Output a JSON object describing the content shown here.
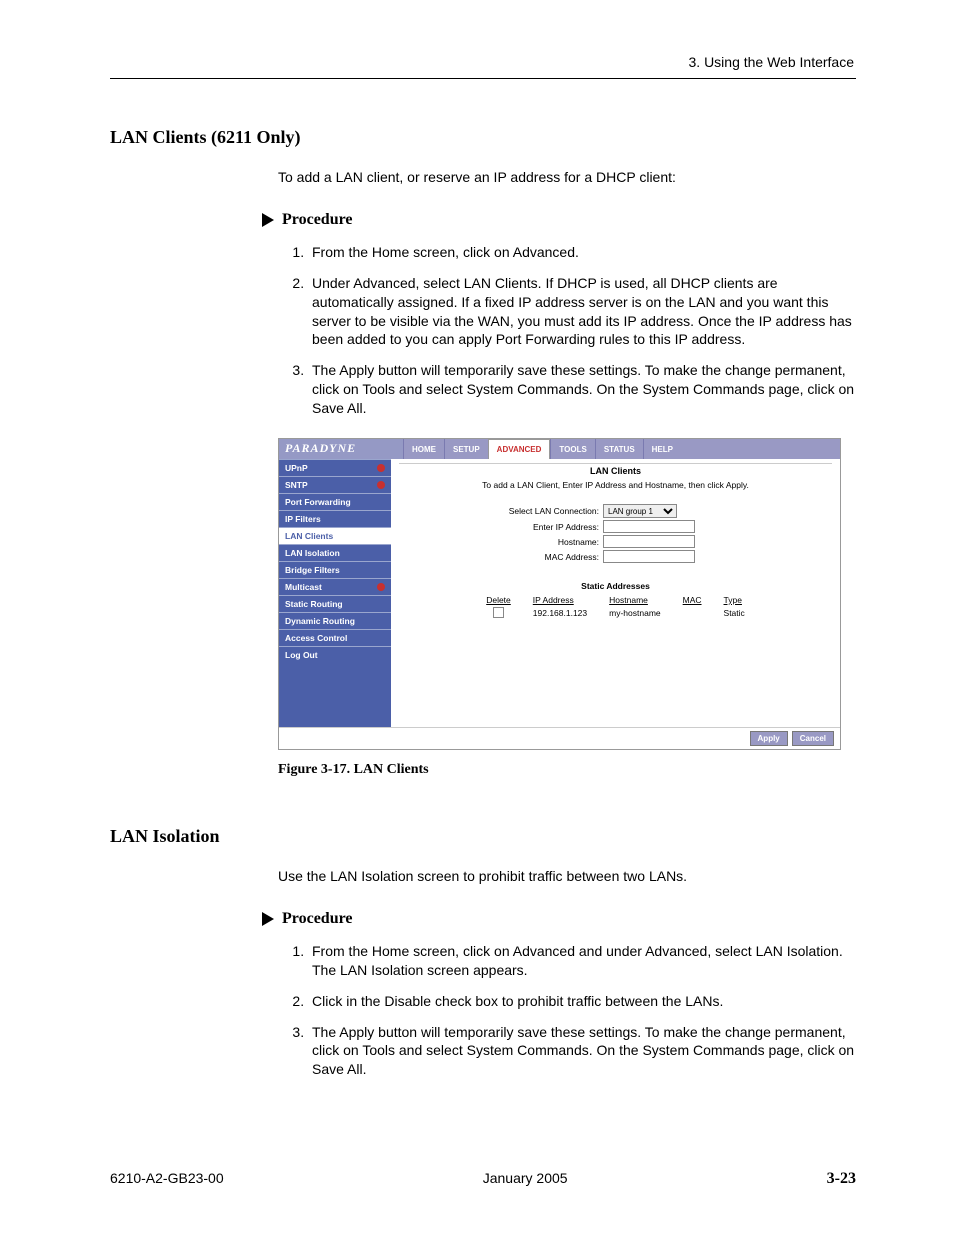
{
  "header": {
    "breadcrumb": "3. Using the Web Interface"
  },
  "section1": {
    "title": "LAN Clients (6211 Only)",
    "intro": "To add a LAN client, or reserve an IP address for a DHCP client:",
    "procedure_label": "Procedure",
    "steps": [
      "From the Home screen, click on Advanced.",
      "Under Advanced, select LAN Clients. If DHCP is used, all DHCP clients are automatically assigned. If a fixed IP address server is on the LAN and you want this server to be visible via the WAN, you must add its IP address. Once the IP address has been added to you can apply Port Forwarding rules to this IP address.",
      "The Apply button will temporarily save these settings. To make the change permanent, click on Tools and select System Commands. On the System Commands page, click on Save All."
    ]
  },
  "figure": {
    "logo": "PARADYNE",
    "nav": [
      "HOME",
      "SETUP",
      "ADVANCED",
      "TOOLS",
      "STATUS",
      "HELP"
    ],
    "sidebar": [
      "UPnP",
      "SNTP",
      "Port Forwarding",
      "IP Filters",
      "LAN Clients",
      "LAN Isolation",
      "Bridge Filters",
      "Multicast",
      "Static Routing",
      "Dynamic Routing",
      "Access Control",
      "Log Out"
    ],
    "panel_title": "LAN Clients",
    "panel_sub": "To add a LAN Client, Enter IP Address and Hostname, then click Apply.",
    "form": {
      "select_label": "Select LAN Connection:",
      "select_value": "LAN group 1",
      "ip_label": "Enter IP Address:",
      "hostname_label": "Hostname:",
      "mac_label": "MAC Address:"
    },
    "static_title": "Static Addresses",
    "table_headers": [
      "Delete",
      "IP Address",
      "Hostname",
      "MAC",
      "Type"
    ],
    "table_row": {
      "ip": "192.168.1.123",
      "host": "my-hostname",
      "mac": "",
      "type": "Static"
    },
    "buttons": {
      "apply": "Apply",
      "cancel": "Cancel"
    },
    "caption": "Figure 3-17.   LAN Clients"
  },
  "section2": {
    "title": "LAN Isolation",
    "intro": "Use the LAN Isolation screen to prohibit traffic between two LANs.",
    "procedure_label": "Procedure",
    "steps": [
      "From the Home screen, click on Advanced and under Advanced, select LAN Isolation. The LAN Isolation screen appears.",
      "Click in the Disable check box to prohibit traffic between the LANs.",
      "The Apply button will temporarily save these settings. To make the change permanent, click on Tools and select System Commands. On the System Commands page, click on Save All."
    ]
  },
  "footer": {
    "doc": "6210-A2-GB23-00",
    "date": "January 2005",
    "page": "3-23"
  }
}
